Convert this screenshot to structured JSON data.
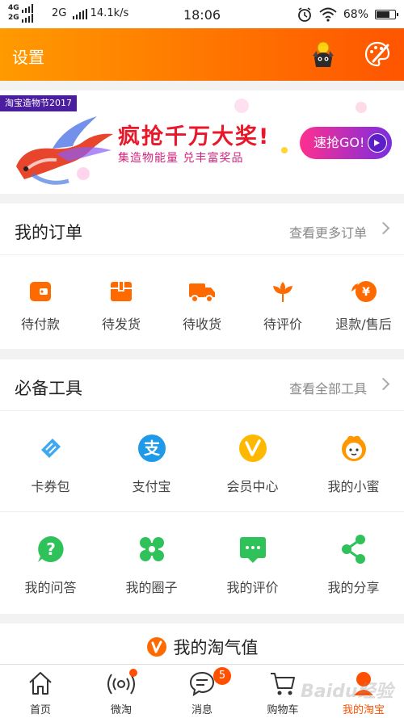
{
  "status_bar": {
    "sim1": "4G",
    "sim2": "2G",
    "network": "2G",
    "speed": "14.1k/s",
    "time": "18:06",
    "battery": "68%",
    "battery_level": 0.68
  },
  "header": {
    "title": "设置",
    "mascot_icon": "mascot-avatar-icon",
    "skin_icon": "palette-icon"
  },
  "banner": {
    "tag": "淘宝造物节2017",
    "headline": "疯抢千万大奖!",
    "subline": "集造物能量  兑丰富奖品",
    "button": "速抢GO!"
  },
  "orders": {
    "title": "我的订单",
    "more": "查看更多订单",
    "items": [
      {
        "label": "待付款",
        "icon": "wallet-icon"
      },
      {
        "label": "待发货",
        "icon": "package-icon"
      },
      {
        "label": "待收货",
        "icon": "truck-icon"
      },
      {
        "label": "待评价",
        "icon": "flower-icon"
      },
      {
        "label": "退款/售后",
        "icon": "refund-icon"
      }
    ]
  },
  "tools": {
    "title": "必备工具",
    "more": "查看全部工具",
    "items": [
      {
        "label": "卡券包",
        "icon": "ticket-icon"
      },
      {
        "label": "支付宝",
        "icon": "alipay-icon"
      },
      {
        "label": "会员中心",
        "icon": "vip-icon"
      },
      {
        "label": "我的小蜜",
        "icon": "assistant-icon"
      },
      {
        "label": "我的问答",
        "icon": "question-icon"
      },
      {
        "label": "我的圈子",
        "icon": "circles-icon"
      },
      {
        "label": "我的评价",
        "icon": "comment-icon"
      },
      {
        "label": "我的分享",
        "icon": "share-icon"
      }
    ]
  },
  "taoqi": {
    "title": "我的淘气值"
  },
  "bottom_nav": {
    "items": [
      {
        "label": "首页",
        "icon": "home-icon"
      },
      {
        "label": "微淘",
        "icon": "broadcast-icon"
      },
      {
        "label": "消息",
        "icon": "message-icon",
        "badge": "5"
      },
      {
        "label": "购物车",
        "icon": "cart-icon"
      },
      {
        "label": "我的淘宝",
        "icon": "profile-icon"
      }
    ]
  },
  "watermark": "Baidu经验",
  "colors": {
    "brand_orange": "#ff5000",
    "header_start": "#ff9a00",
    "header_end": "#ff5500"
  }
}
